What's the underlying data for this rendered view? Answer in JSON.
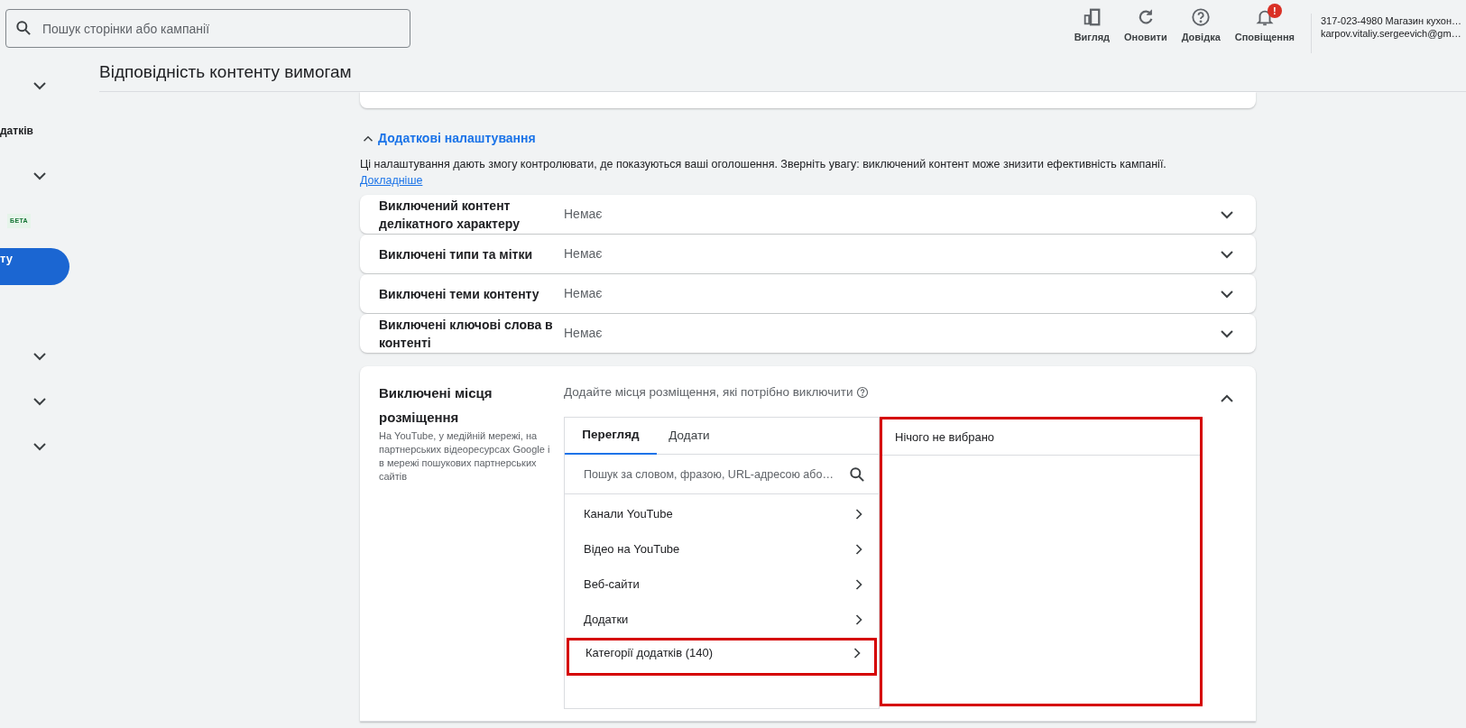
{
  "search": {
    "placeholder": "Пошук сторінки або кампанії"
  },
  "toolbar": [
    {
      "kind": "view",
      "label": "Вигляд"
    },
    {
      "kind": "refresh",
      "label": "Оновити"
    },
    {
      "kind": "help",
      "label": "Довідка"
    },
    {
      "kind": "notifications",
      "label": "Сповіщення",
      "badge": "!"
    }
  ],
  "account": {
    "line_1": "317-023-4980 Магазин кухон…",
    "line_2": "karpov.vitaliy.sergeevich@gm…"
  },
  "sidebar": {
    "groups": [
      {
        "items": [
          {
            "kind": "expander",
            "expanded": false
          },
          {
            "kind": "label",
            "text": "датків",
            "selected": false
          },
          {
            "kind": "expander",
            "expanded": false
          },
          {
            "kind": "badge",
            "text": "БЕТА"
          },
          {
            "kind": "label",
            "text": "ту",
            "selected": true
          }
        ]
      },
      {
        "items": [
          {
            "kind": "expander",
            "expanded": false
          },
          {
            "kind": "expander",
            "expanded": false
          },
          {
            "kind": "expander",
            "expanded": false
          }
        ]
      }
    ]
  },
  "page_title": "Відповідність контенту вимогам",
  "advanced": {
    "title": "Додаткові налаштування",
    "expanded": true,
    "description": "Ці налаштування дають змогу контролювати, де показуються ваші оголошення. Зверніть увагу: виключений контент може знизити ефективність кампанії.",
    "link": "Докладніше"
  },
  "settings": [
    {
      "label": "Виключений контент делікатного характеру",
      "value": "Немає",
      "expanded": false
    },
    {
      "label": "Виключені типи та мітки",
      "value": "Немає",
      "expanded": false
    },
    {
      "label": "Виключені теми контенту",
      "value": "Немає",
      "expanded": false
    },
    {
      "label": "Виключені ключові слова в контенті",
      "value": "Немає",
      "expanded": false
    }
  ],
  "placements": {
    "label": "Виключені місця розміщення",
    "description": "На YouTube, у медійній мережі, на партнерських відеоресурсах Google і в мережі пошукових партнерських сайтів",
    "prompt": "Додайте місця розміщення, які потрібно виключити",
    "expanded": true,
    "tabs": [
      {
        "label": "Перегляд",
        "selected": true
      },
      {
        "label": "Додати",
        "selected": false
      }
    ],
    "search": {
      "placeholder": "Пошук за словом, фразою, URL-адресою або…"
    },
    "categories": [
      {
        "label": "Канали YouTube",
        "highlighted": false
      },
      {
        "label": "Відео на YouTube",
        "highlighted": false
      },
      {
        "label": "Веб-сайти",
        "highlighted": false
      },
      {
        "label": "Додатки",
        "highlighted": false
      },
      {
        "label": "Категорії додатків (140)",
        "highlighted": true
      }
    ],
    "selection": {
      "empty_text": "Нічого не вибрано",
      "highlighted": true
    }
  }
}
